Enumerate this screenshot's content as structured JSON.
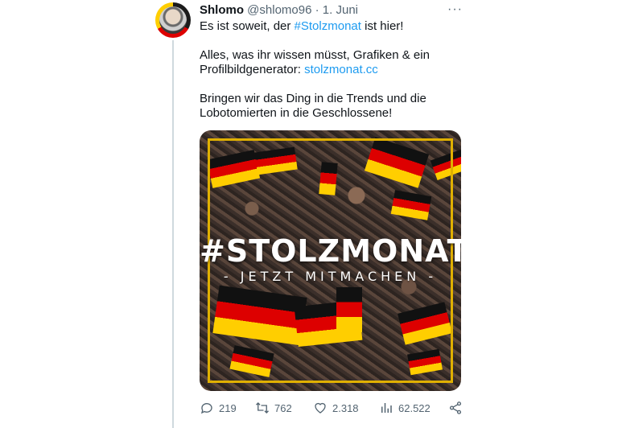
{
  "tweet": {
    "author_name": "Shlomo",
    "author_handle": "@shlomo96",
    "separator": "·",
    "date": "1. Juni",
    "more_label": "···",
    "line1_before": "Es ist soweit, der ",
    "line1_hashtag": "#Stolzmonat",
    "line1_after": " ist hier!",
    "para2_text": "Alles, was ihr wissen müsst, Grafiken & ein Profilbildgenerator: ",
    "para2_link": "stolzmonat.cc",
    "para3_text": "Bringen wir das Ding in die Trends und die Lobotomierten in die Geschlossene!"
  },
  "media": {
    "title": "#STOLZMONAT",
    "subtitle": "- JETZT MITMACHEN -",
    "flag_colors": [
      "#111111",
      "#dd0000",
      "#ffce00"
    ],
    "frame_color": "#e0b000"
  },
  "actions": {
    "replies": "219",
    "retweets": "762",
    "likes": "2.318",
    "views": "62.522"
  },
  "colors": {
    "link": "#1d9bf0",
    "secondary_text": "#536471"
  }
}
